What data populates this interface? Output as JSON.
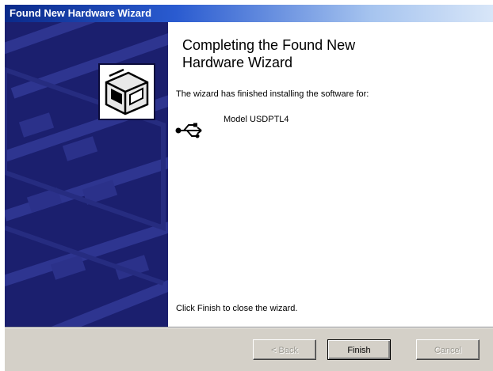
{
  "window": {
    "title": "Found New Hardware Wizard"
  },
  "main": {
    "heading_line1": "Completing the Found New",
    "heading_line2": "Hardware Wizard",
    "description": "The wizard has finished installing the software for:",
    "device": {
      "icon": "usb-icon",
      "name": "Model USDPTL4"
    },
    "finish_hint": "Click Finish to close the wizard."
  },
  "buttons": {
    "back_label": "< Back",
    "finish_label": "Finish",
    "cancel_label": "Cancel"
  },
  "colors": {
    "side_panel": "#1b1f6e",
    "title_bar_start": "#0a2a8a",
    "dialog_face": "#d4d0c8"
  }
}
